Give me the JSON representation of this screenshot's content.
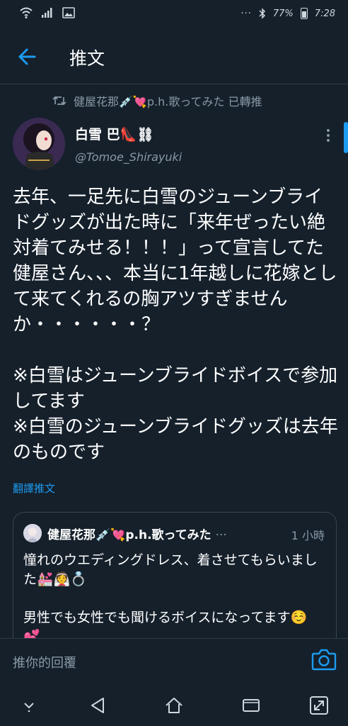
{
  "status_bar": {
    "battery": "77%",
    "time": "7:28"
  },
  "header": {
    "title": "推文"
  },
  "retweet": {
    "text": "健屋花那💉💘p.h.歌ってみた 已轉推"
  },
  "author": {
    "name": "白雪 巴👠⛓",
    "handle": "@Tomoe_Shirayuki"
  },
  "tweet": {
    "text": "去年、一足先に白雪のジューンブライドグッズが出た時に「来年ぜったい絶対着てみせる！！！」って宣言してた健屋さん、、、本当に1年越しに花嫁として来てくれるの胸アツすぎませんか・・・・・・？\n\n※白雪はジューンブライドボイスで参加してます\n※白雪のジューンブライドグッズは去年のものです",
    "translate_label": "翻譯推文"
  },
  "quote": {
    "author": "健屋花那💉💘p.h.歌ってみた",
    "ellipsis": "···",
    "time": "1 小時",
    "text": "憧れのウエディングドレス、着させてもらいました💒👰💍\n\n男性でも女性でも聞けるボイスになってます☺️💕..."
  },
  "reply": {
    "placeholder": "推你的回覆"
  },
  "colors": {
    "background": "#15202b",
    "accent": "#1d9bf0",
    "secondary_text": "#8899a6",
    "border": "#38444d"
  },
  "icons": [
    "wifi-icon",
    "signal-icon",
    "gallery-icon",
    "more-dots-icon",
    "bluetooth-icon",
    "back-arrow-icon",
    "retweet-icon",
    "more-vertical-icon",
    "camera-icon",
    "nav-down-icon",
    "nav-back-icon",
    "nav-home-icon",
    "nav-recents-icon",
    "nav-expand-icon"
  ]
}
